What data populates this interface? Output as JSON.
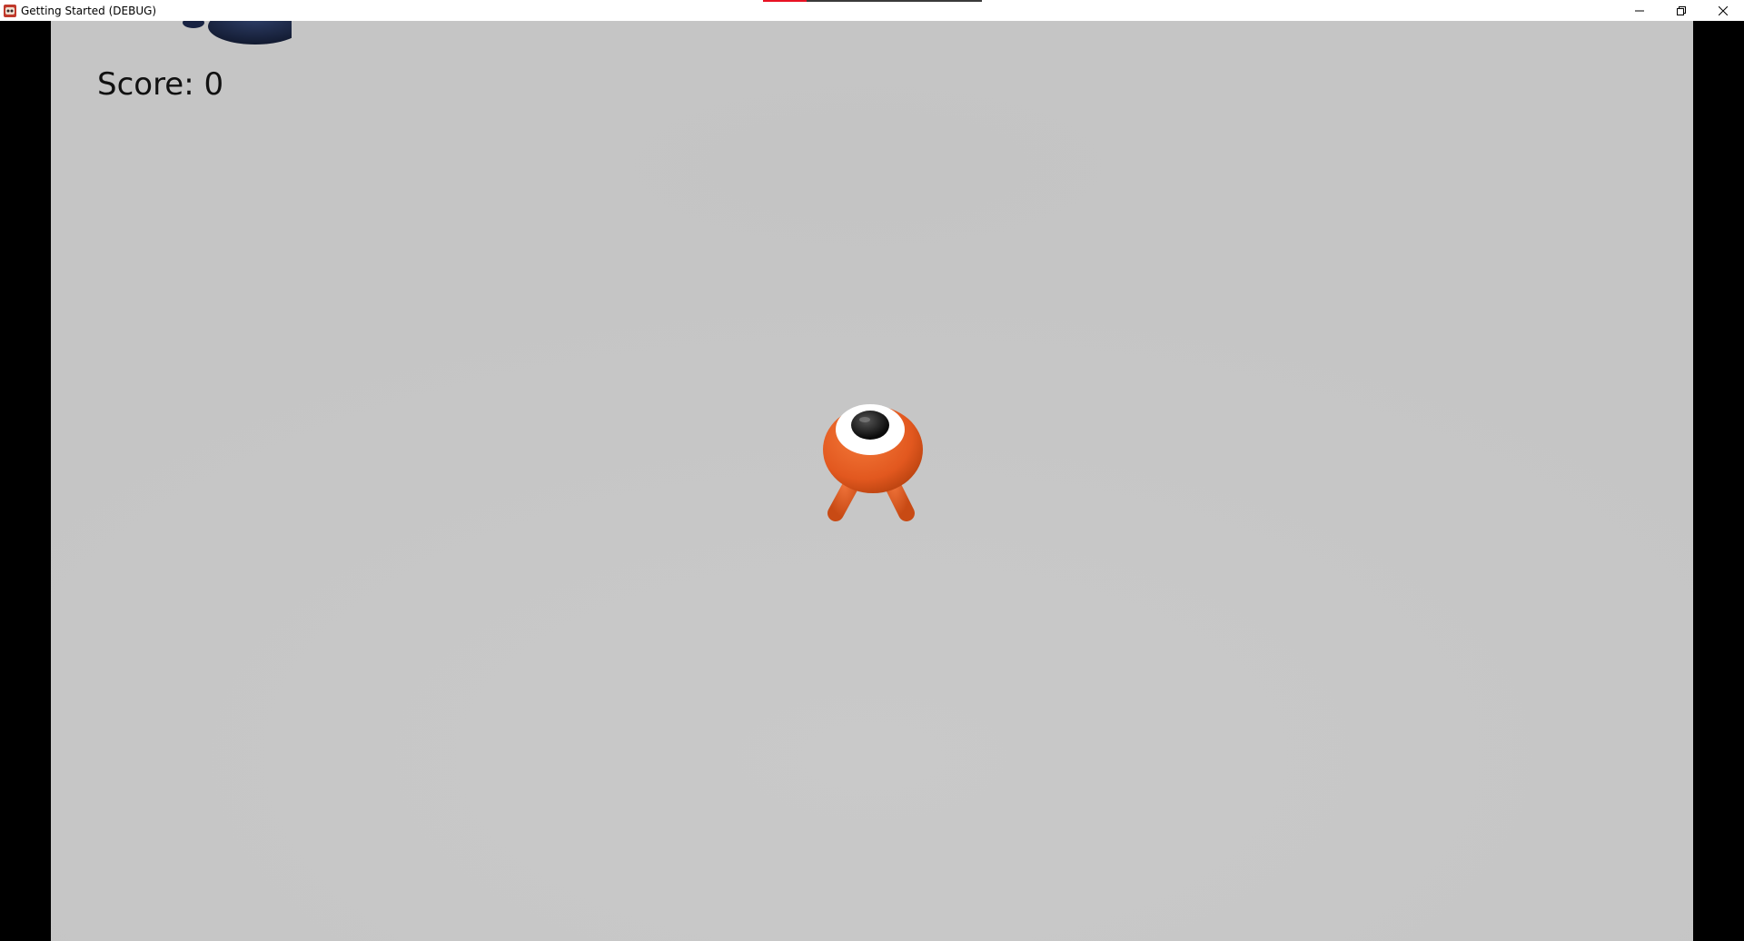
{
  "window": {
    "title": "Getting Started (DEBUG)",
    "app_icon": "godot-icon",
    "controls": [
      "minimize-icon",
      "restore-icon",
      "close-icon"
    ]
  },
  "loading_strip": {
    "progress": 0.2
  },
  "hud": {
    "score_label": "Score: 0"
  },
  "scene": {
    "background_color": "#c8c8c8",
    "player": {
      "body_color": "#e2581f",
      "eye_white": "#ffffff",
      "pupil_color": "#111111"
    },
    "enemy": {
      "color": "#1d2a4a"
    }
  }
}
